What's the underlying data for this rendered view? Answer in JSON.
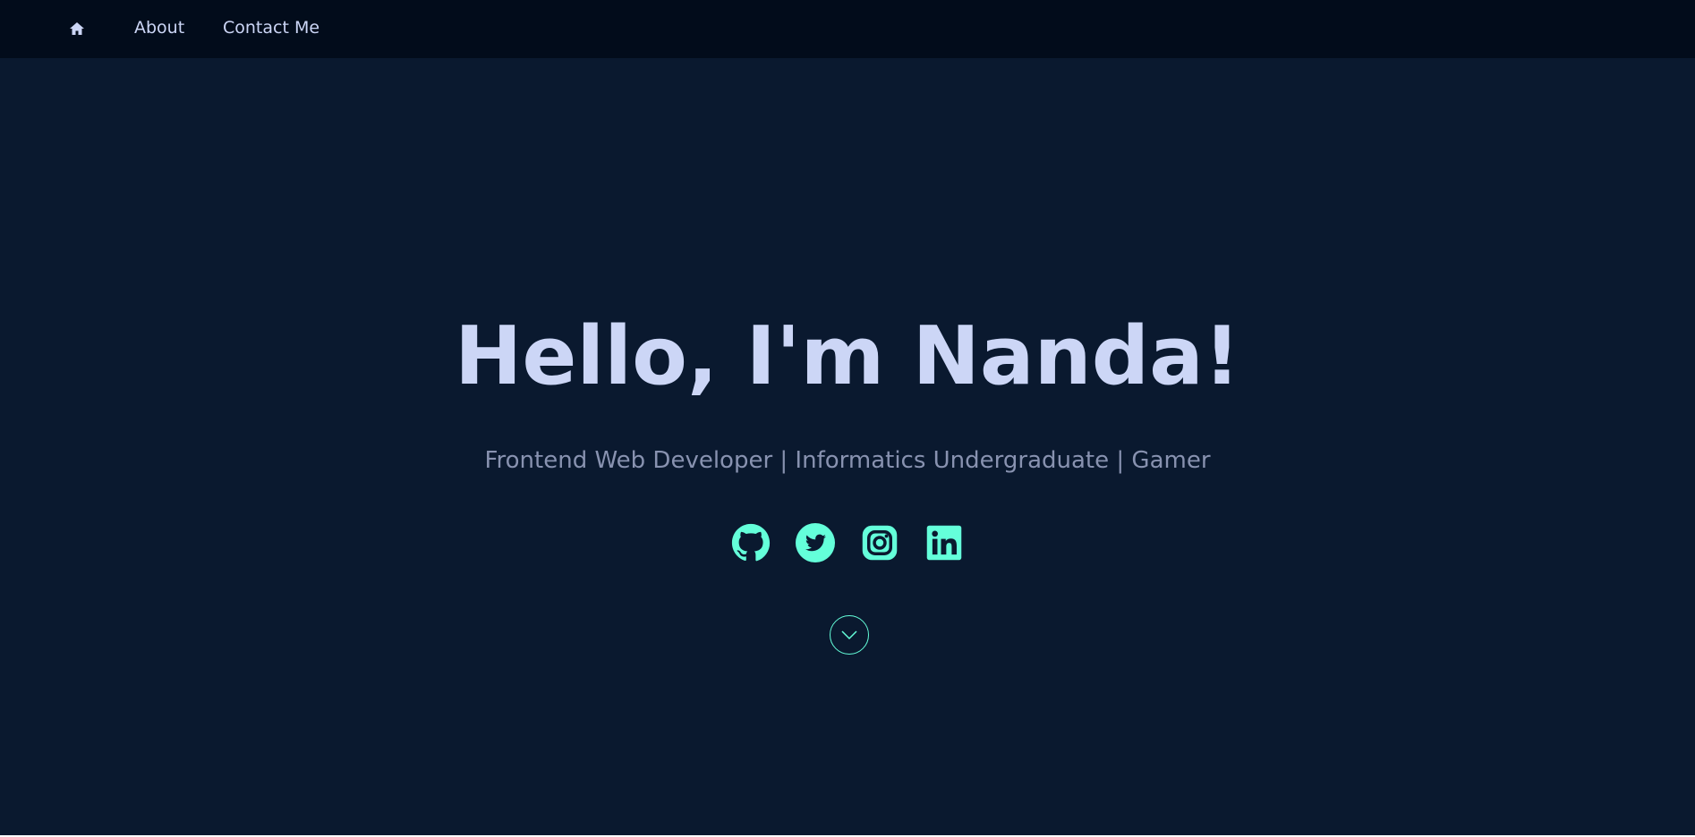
{
  "nav": {
    "home_icon": "home-icon",
    "links": [
      {
        "label": "About"
      },
      {
        "label": "Contact Me"
      }
    ]
  },
  "hero": {
    "title": "Hello, I'm Nanda!",
    "subtitle": "Frontend Web Developer | Informatics Undergraduate | Gamer",
    "socials": [
      {
        "icon": "github-icon"
      },
      {
        "icon": "twitter-icon"
      },
      {
        "icon": "instagram-icon"
      },
      {
        "icon": "linkedin-icon"
      }
    ],
    "scroll_icon": "chevron-down-icon"
  },
  "colors": {
    "background": "#0a192f",
    "navbar": "#020c1b",
    "heading": "#ccd6f6",
    "subtitle": "#8892b0",
    "accent": "#64ffda"
  }
}
